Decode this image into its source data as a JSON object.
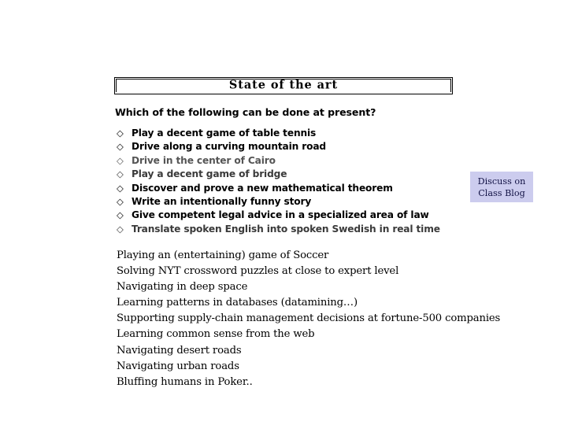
{
  "slide": {
    "title": "State of the art",
    "question": "Which of the following can be done at present?",
    "background_color": "#ffffff",
    "text_color": "#000000"
  },
  "bullets": {
    "glyph": "◇",
    "items": [
      {
        "label": "Play a decent game of table tennis"
      },
      {
        "label": "Drive along a curving mountain road"
      },
      {
        "label": "Drive in the center of Cairo"
      },
      {
        "label": "Play a decent game of bridge"
      },
      {
        "label": "Discover and prove a new mathematical theorem"
      },
      {
        "label": "Write an intentionally funny story"
      },
      {
        "label": "Give competent legal advice in a specialized area of law"
      },
      {
        "label": "Translate spoken English into spoken Swedish in real time"
      }
    ]
  },
  "notes": {
    "lines": [
      "Playing an (entertaining) game of Soccer",
      "Solving NYT crossword puzzles at close to expert level",
      "Navigating in deep space",
      "Learning patterns in databases (datamining…)",
      "Supporting supply-chain management decisions at fortune-500 companies",
      "Learning common sense from the web",
      "Navigating desert roads",
      "Navigating urban roads",
      "Bluffing humans in Poker.."
    ]
  },
  "discuss_box": {
    "line1": "Discuss on",
    "line2": "Class Blog",
    "background_color": "#ccccee",
    "text_color": "#121245"
  }
}
